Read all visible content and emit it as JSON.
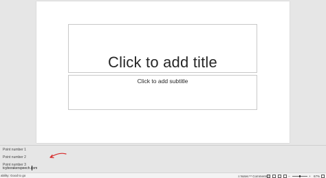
{
  "slide": {
    "title_placeholder": "Click to add title",
    "subtitle_placeholder": "Click to add subtitle"
  },
  "notes": {
    "lines": [
      "Point number 1",
      "Point number 2",
      "Point number 3",
      "tcyborakerspeech.com"
    ],
    "annotation_color": "#d62828"
  },
  "statusbar": {
    "left_text": "ability: Good to go",
    "notes_label": "Notes",
    "comments_label": "Comments",
    "zoom_text": "67%",
    "zoom_level": 0.67
  }
}
